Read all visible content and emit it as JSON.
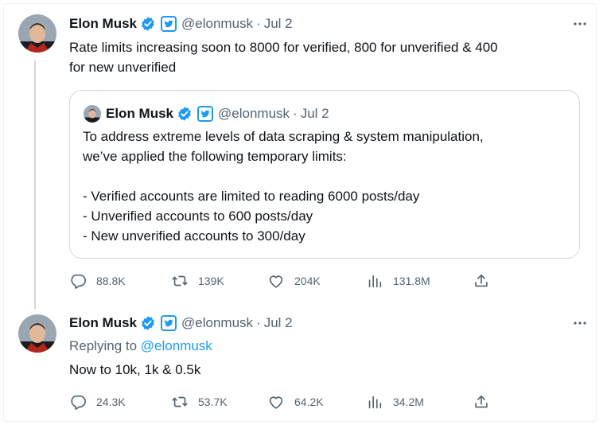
{
  "tweet1": {
    "author_name": "Elon Musk",
    "handle": "@elonmusk",
    "separator": "·",
    "date": "Jul 2",
    "text_line1": "Rate limits increasing soon to 8000 for verified, 800 for unverified & 400",
    "text_line2": "for new unverified",
    "quote": {
      "author_name": "Elon Musk",
      "handle": "@elonmusk",
      "separator": "·",
      "date": "Jul 2",
      "lines": [
        "To address extreme levels of data scraping & system manipulation,",
        "we’ve applied the following temporary limits:",
        "",
        "- Verified accounts are limited to reading 6000 posts/day",
        "- Unverified accounts to 600 posts/day",
        "- New unverified accounts to 300/day"
      ]
    },
    "stats": {
      "replies": "88.8K",
      "reposts": "139K",
      "likes": "204K",
      "views": "131.8M"
    }
  },
  "tweet2": {
    "author_name": "Elon Musk",
    "handle": "@elonmusk",
    "separator": "·",
    "date": "Jul 2",
    "replying_prefix": "Replying to",
    "replying_handle": "@elonmusk",
    "text": "Now to 10k, 1k & 0.5k",
    "stats": {
      "replies": "24.3K",
      "reposts": "53.7K",
      "likes": "64.2K",
      "views": "34.2M"
    }
  },
  "icons": {
    "verified": "verified-badge-icon",
    "affiliate": "twitter-bird-badge-icon",
    "more": "more-horizontal-icon",
    "reply": "reply-bubble-icon",
    "repost": "repost-icon",
    "like": "heart-icon",
    "views": "bar-chart-icon",
    "share": "share-icon"
  },
  "colors": {
    "accent": "#1d9bf0",
    "text": "#0f1419",
    "muted": "#536471",
    "border": "#cfd9de"
  }
}
